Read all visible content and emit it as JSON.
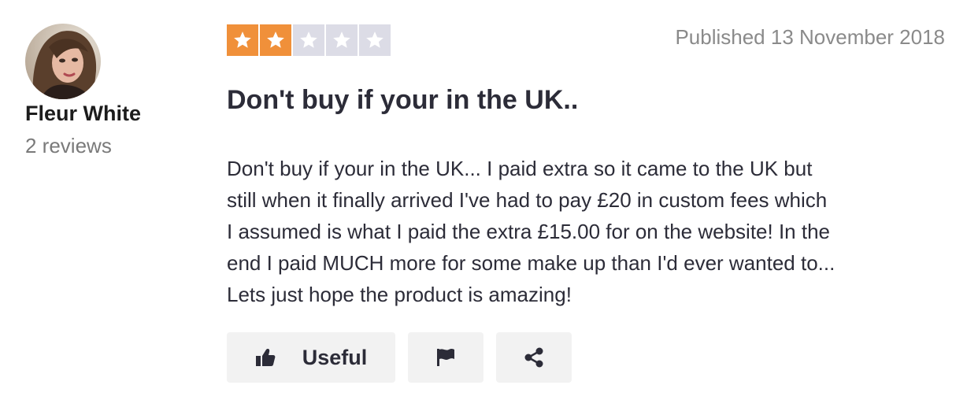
{
  "reviewer": {
    "name": "Fleur White",
    "review_count": "2 reviews",
    "avatar_icon": "user-photo"
  },
  "rating": {
    "value": 2,
    "max": 5,
    "filled_color": "#f0903a",
    "empty_color": "#dcdce6"
  },
  "published": "Published 13 November 2018",
  "review": {
    "title": "Don't buy if your in the UK..",
    "body_lines": [
      "Don't buy if your in the UK... I paid extra so it came to the UK but",
      "still when it finally arrived I've had to pay £20 in custom fees which",
      "I assumed is what I paid the extra £15.00 for on the website! In the",
      "end I paid MUCH more for some make up than I'd ever wanted to...",
      "Lets just hope the product is amazing!"
    ]
  },
  "actions": {
    "useful_label": "Useful",
    "useful_icon": "thumbs-up-icon",
    "flag_icon": "flag-icon",
    "share_icon": "share-icon"
  }
}
